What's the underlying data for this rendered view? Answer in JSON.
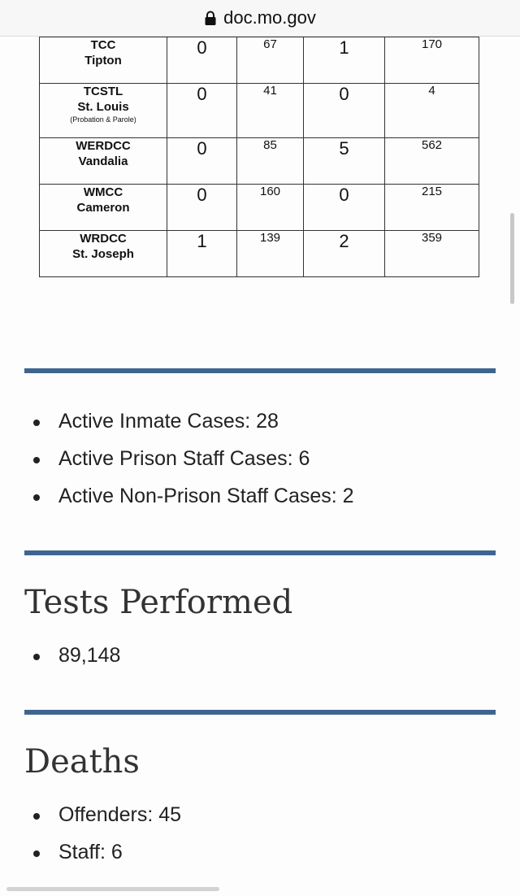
{
  "browser": {
    "url": "doc.mo.gov"
  },
  "table": {
    "rows": [
      {
        "name": "TCC",
        "location": "Tipton",
        "note": "",
        "col1": "0",
        "col2": "67",
        "col3": "1",
        "col4": "170"
      },
      {
        "name": "TCSTL",
        "location": "St. Louis",
        "note": "(Probation & Parole)",
        "col1": "0",
        "col2": "41",
        "col3": "0",
        "col4": "4"
      },
      {
        "name": "WERDCC",
        "location": "Vandalia",
        "note": "",
        "col1": "0",
        "col2": "85",
        "col3": "5",
        "col4": "562"
      },
      {
        "name": "WMCC",
        "location": "Cameron",
        "note": "",
        "col1": "0",
        "col2": "160",
        "col3": "0",
        "col4": "215"
      },
      {
        "name": "WRDCC",
        "location": "St. Joseph",
        "note": "",
        "col1": "1",
        "col2": "139",
        "col3": "2",
        "col4": "359"
      }
    ]
  },
  "active_cases": {
    "items": [
      "Active Inmate Cases: 28",
      "Active Prison Staff Cases: 6",
      "Active Non-Prison Staff Cases: 2"
    ]
  },
  "tests": {
    "heading": "Tests Performed",
    "items": [
      "89,148"
    ]
  },
  "deaths": {
    "heading": "Deaths",
    "items": [
      "Offenders: 45",
      "Staff: 6"
    ]
  },
  "colors": {
    "rule": "#3e6590",
    "text": "#222222"
  }
}
